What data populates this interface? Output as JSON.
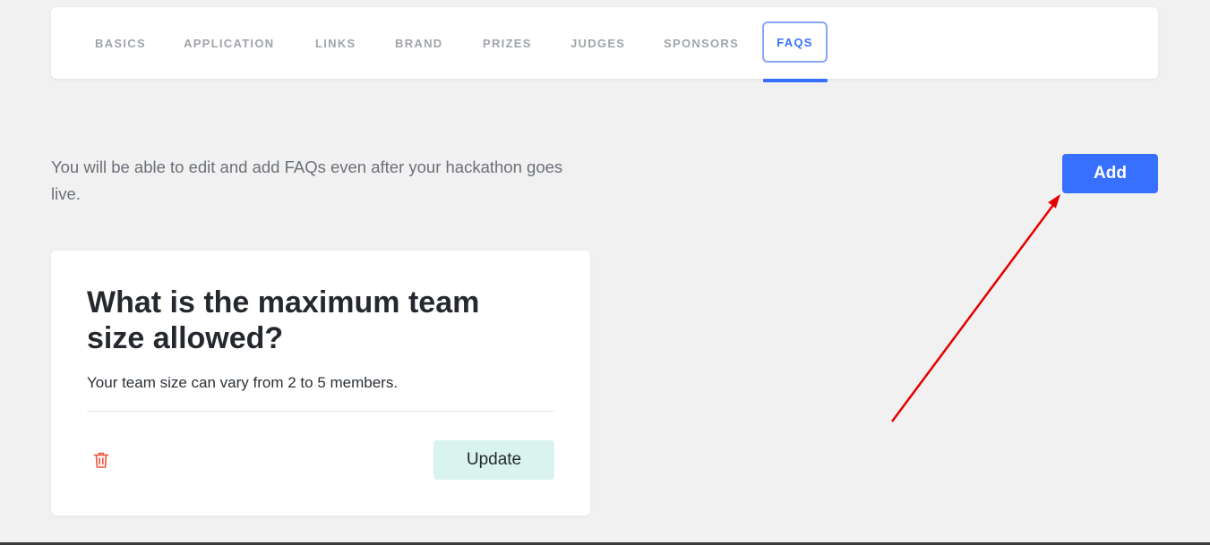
{
  "tabs": [
    {
      "label": "BASICS",
      "active": false
    },
    {
      "label": "APPLICATION",
      "active": false
    },
    {
      "label": "LINKS",
      "active": false
    },
    {
      "label": "BRAND",
      "active": false
    },
    {
      "label": "PRIZES",
      "active": false
    },
    {
      "label": "JUDGES",
      "active": false
    },
    {
      "label": "SPONSORS",
      "active": false
    },
    {
      "label": "FAQS",
      "active": true
    }
  ],
  "intro_text": "You will be able to edit and add FAQs even after your hackathon goes live.",
  "add_button_label": "Add",
  "faq": {
    "question": "What is the maximum team size allowed?",
    "answer": "Your team size can vary from 2 to 5 members.",
    "update_label": "Update",
    "delete_icon": "trash-icon"
  },
  "colors": {
    "accent": "#3770ff",
    "delete": "#e8553e",
    "update_bg": "#d9f4ee",
    "annotation_arrow": "#e50000",
    "background": "#f1f1f1"
  }
}
